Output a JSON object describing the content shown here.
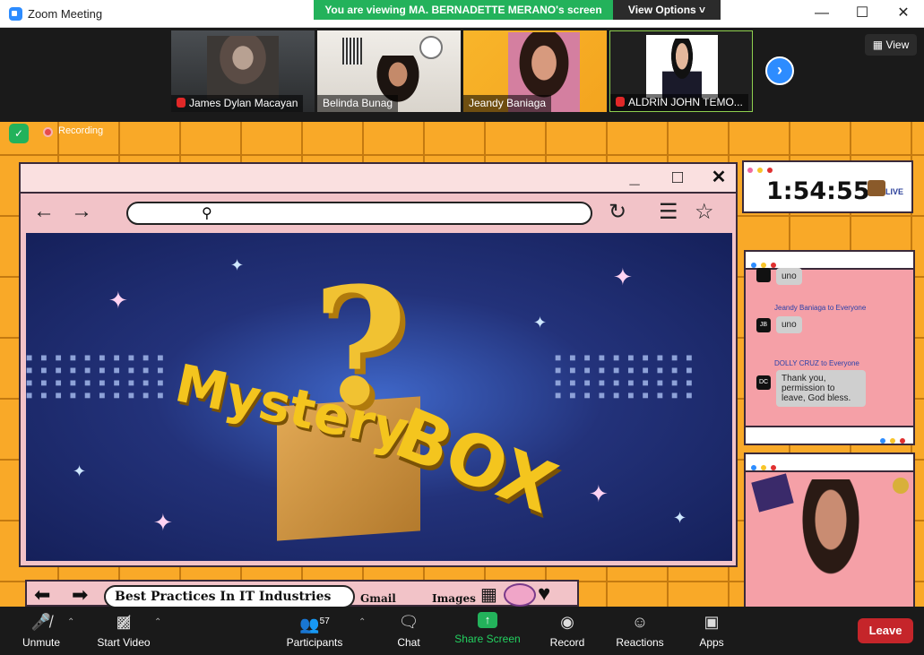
{
  "window": {
    "title": "Zoom Meeting",
    "banner": "You are viewing MA. BERNADETTE MERANO's screen",
    "view_options": "View Options ˅",
    "minimize": "—",
    "maximize": "☐",
    "close": "✕"
  },
  "participants_strip": [
    {
      "name": "James Dylan Macayan",
      "muted": true
    },
    {
      "name": "Belinda Bunag",
      "muted": false
    },
    {
      "name": "Jeandy Baniaga",
      "muted": false
    },
    {
      "name": "ALDRIN JOHN TEMO...",
      "muted": true
    }
  ],
  "view_button": "View",
  "recording_label": "Recording",
  "shared_slide": {
    "hero_word1": "Mystery",
    "hero_word2": "BOX",
    "bottom_title": "Best Practices In IT Industries",
    "gmail": "Gmail",
    "images": "Images"
  },
  "timer": "1:54:55",
  "live_badge": "LIVE",
  "chat": {
    "messages": [
      {
        "sender": "",
        "text": "uno",
        "avatar": ""
      },
      {
        "sender": "Jeandy Baniaga to Everyone",
        "text": "uno",
        "avatar": "JB"
      },
      {
        "sender": "DOLLY CRUZ to Everyone",
        "text": "Thank you, permission to leave, God bless.",
        "avatar": "DC"
      }
    ]
  },
  "toolbar": {
    "unmute": "Unmute",
    "start_video": "Start Video",
    "participants": "Participants",
    "participants_count": "57",
    "chat": "Chat",
    "share_screen": "Share Screen",
    "record": "Record",
    "reactions": "Reactions",
    "apps": "Apps",
    "leave": "Leave"
  },
  "colors": {
    "zoom_blue": "#2d8cff",
    "banner_green": "#23b25b",
    "leave_red": "#c5252a",
    "slide_orange": "#f9a928"
  }
}
